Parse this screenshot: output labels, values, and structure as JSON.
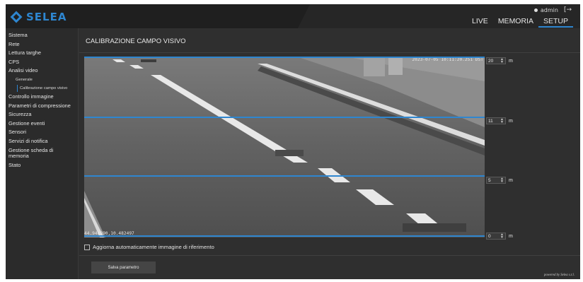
{
  "header": {
    "brand": "SELEA",
    "user": "admin",
    "logout_icon": "logout-icon",
    "nav": [
      {
        "label": "LIVE"
      },
      {
        "label": "MEMORIA"
      },
      {
        "label": "SETUP",
        "active": true
      }
    ]
  },
  "sidebar": {
    "items": [
      {
        "label": "Sistema"
      },
      {
        "label": "Rete"
      },
      {
        "label": "Lettura targhe"
      },
      {
        "label": "CPS"
      },
      {
        "label": "Analisi video"
      },
      {
        "label": "Generale",
        "level": 1
      },
      {
        "label": "Calibrazione campo visivo",
        "level": 2,
        "active": true
      },
      {
        "label": "Controllo immagine"
      },
      {
        "label": "Parametri di compressione"
      },
      {
        "label": "Sicurezza"
      },
      {
        "label": "Gestione eventi"
      },
      {
        "label": "Sensori"
      },
      {
        "label": "Servizi di notifica"
      },
      {
        "label": "Gestione scheda di memoria"
      },
      {
        "label": "Stato"
      }
    ]
  },
  "main": {
    "title": "CALIBRAZIONE CAMPO VISIVO",
    "camera": {
      "timestamp": "2023-07-05 10:11:20.251 DST",
      "coordinates": "44.940690,10.482497"
    },
    "distances": [
      {
        "value": "20",
        "unit": "m"
      },
      {
        "value": "11",
        "unit": "m"
      },
      {
        "value": "5",
        "unit": "m"
      },
      {
        "value": "0",
        "unit": "m"
      }
    ],
    "auto_update_label": "Aggiorna automaticamente immagine di riferimento",
    "auto_update_checked": false,
    "save_label": "Salva parametro",
    "powered": "powered by Selea s.r.l."
  },
  "colors": {
    "accent": "#2e86d0",
    "background": "#2f2f2f",
    "topbar": "#262626"
  }
}
